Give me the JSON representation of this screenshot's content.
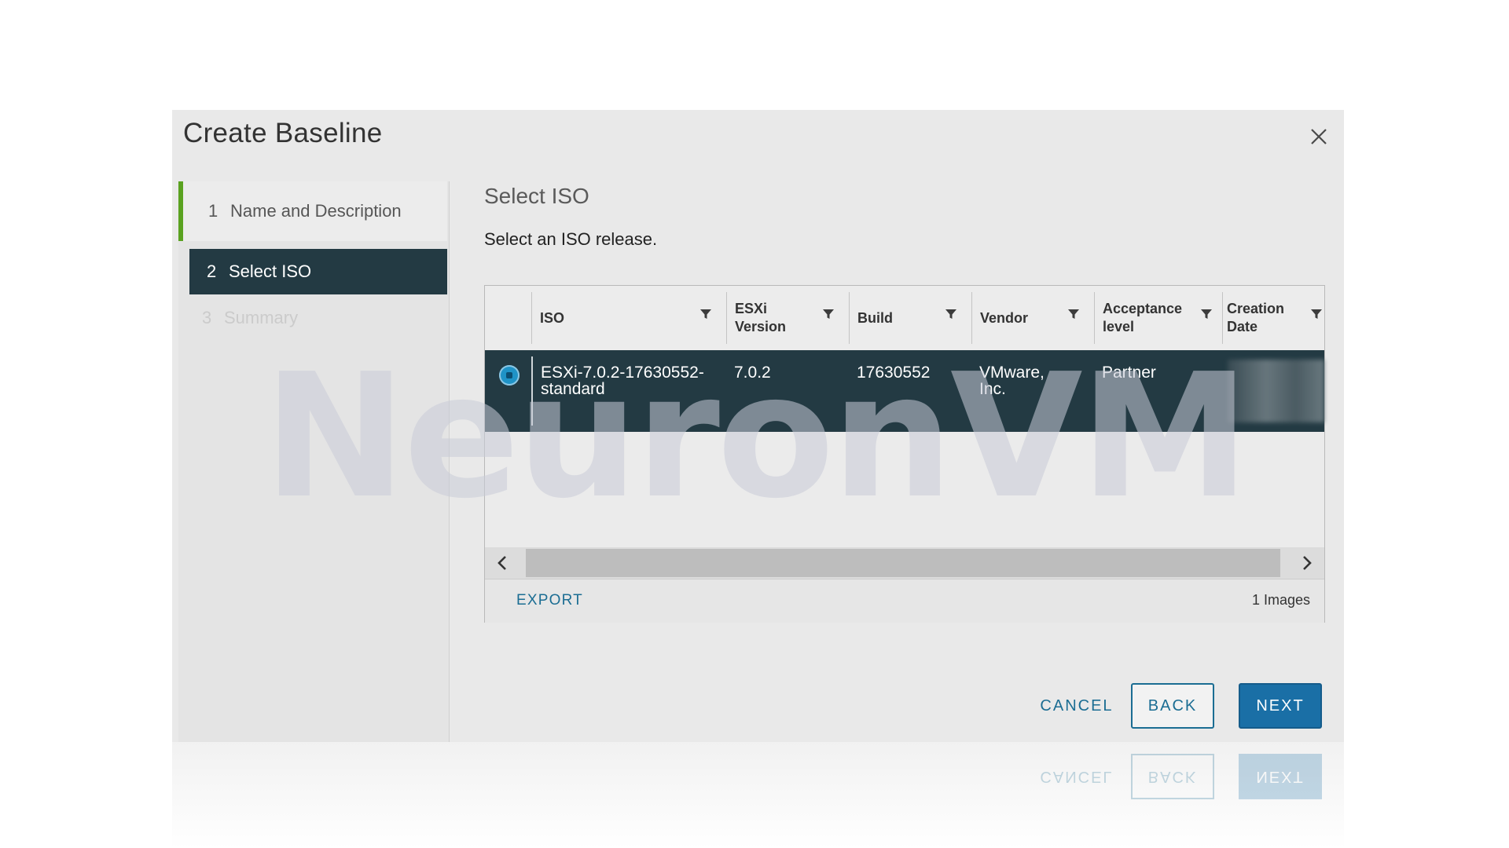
{
  "dialog": {
    "title": "Create Baseline",
    "close_icon": "close-icon"
  },
  "steps": [
    {
      "number": "1",
      "label": "Name and Description",
      "state": "completed"
    },
    {
      "number": "2",
      "label": "Select ISO",
      "state": "active"
    },
    {
      "number": "3",
      "label": "Summary",
      "state": "disabled"
    }
  ],
  "content": {
    "title": "Select ISO",
    "subtitle": "Select an ISO release."
  },
  "grid": {
    "columns": [
      {
        "label": "ISO"
      },
      {
        "label": "ESXi\nVersion"
      },
      {
        "label": "Build"
      },
      {
        "label": "Vendor"
      },
      {
        "label": "Acceptance\nlevel"
      },
      {
        "label": "Creation\nDate"
      }
    ],
    "rows": [
      {
        "selected": true,
        "iso": "ESXi-7.0.2-17630552-standard",
        "esxi_version": "7.0.2",
        "build": "17630552",
        "vendor": "VMware, Inc.",
        "acceptance_level": "Partner"
      }
    ],
    "export_label": "EXPORT",
    "count_label": "1 Images"
  },
  "buttons": {
    "cancel": "CANCEL",
    "back": "BACK",
    "next": "NEXT"
  },
  "watermark": "NeuronVM",
  "colors": {
    "accent": "#1a6fa6",
    "selected_row": "#233a43",
    "step_complete": "#5aa220"
  }
}
